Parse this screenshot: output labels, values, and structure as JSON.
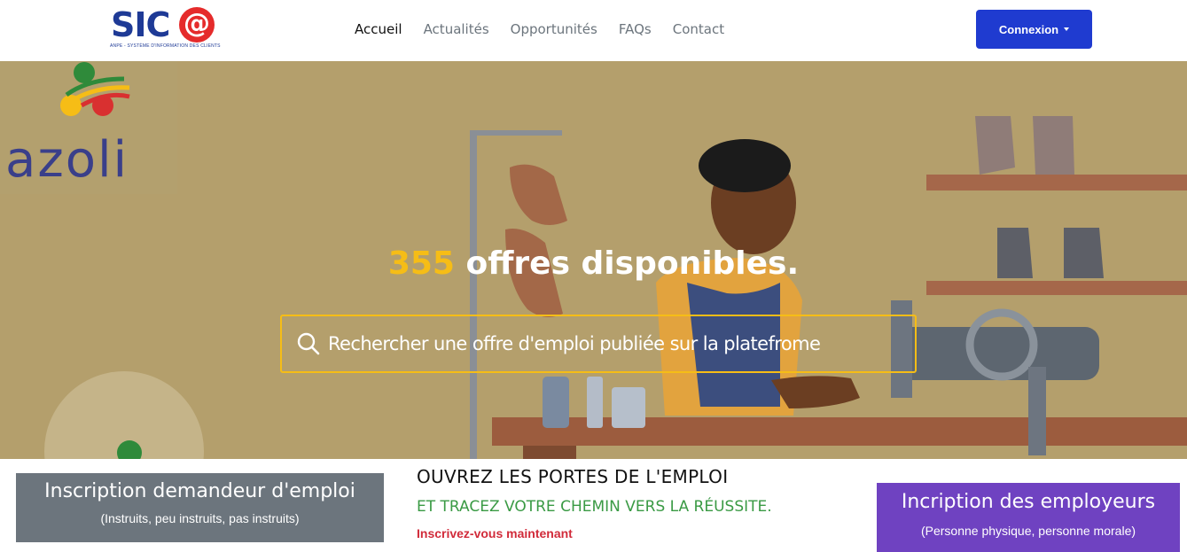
{
  "brand": {
    "logo_text": "SIC",
    "logo_at": "@",
    "logo_subtitle": "ANPE - SYSTÈME D'INFORMATION DES CLIENTS",
    "azoli_text": "azoli"
  },
  "nav": {
    "items": [
      {
        "label": "Accueil",
        "active": true
      },
      {
        "label": "Actualités",
        "active": false
      },
      {
        "label": "Opportunités",
        "active": false
      },
      {
        "label": "FAQs",
        "active": false
      },
      {
        "label": "Contact",
        "active": false
      }
    ],
    "login_label": "Connexion"
  },
  "hero": {
    "offers_count": "355",
    "offers_text": " offres disponibles.",
    "search_placeholder": "Rechercher une offre d'emploi publiée sur la platefrome"
  },
  "cta": {
    "jobseeker": {
      "title": "Inscription demandeur d'emploi",
      "subtitle": "(Instruits, peu instruits, pas instruits)"
    },
    "headline": "OUVREZ LES PORTES DE L'EMPLOI",
    "tagline": "ET TRACEZ VOTRE CHEMIN VERS LA RÉUSSITE.",
    "signup_link": "Inscrivez-vous maintenant",
    "employer": {
      "title": "Incription des employeurs",
      "subtitle": "(Personne physique, personne morale)"
    }
  },
  "colors": {
    "primary_button": "#1f3bd0",
    "accent_yellow": "#f6bd16",
    "hero_bg": "#b49f6c",
    "jobseeker_card": "#6c757d",
    "employer_card": "#6f42c1",
    "tagline_green": "#3a9a44",
    "signup_red": "#d12b3a"
  },
  "icons": {
    "search": "search-icon",
    "dropdown": "caret-down-icon"
  }
}
